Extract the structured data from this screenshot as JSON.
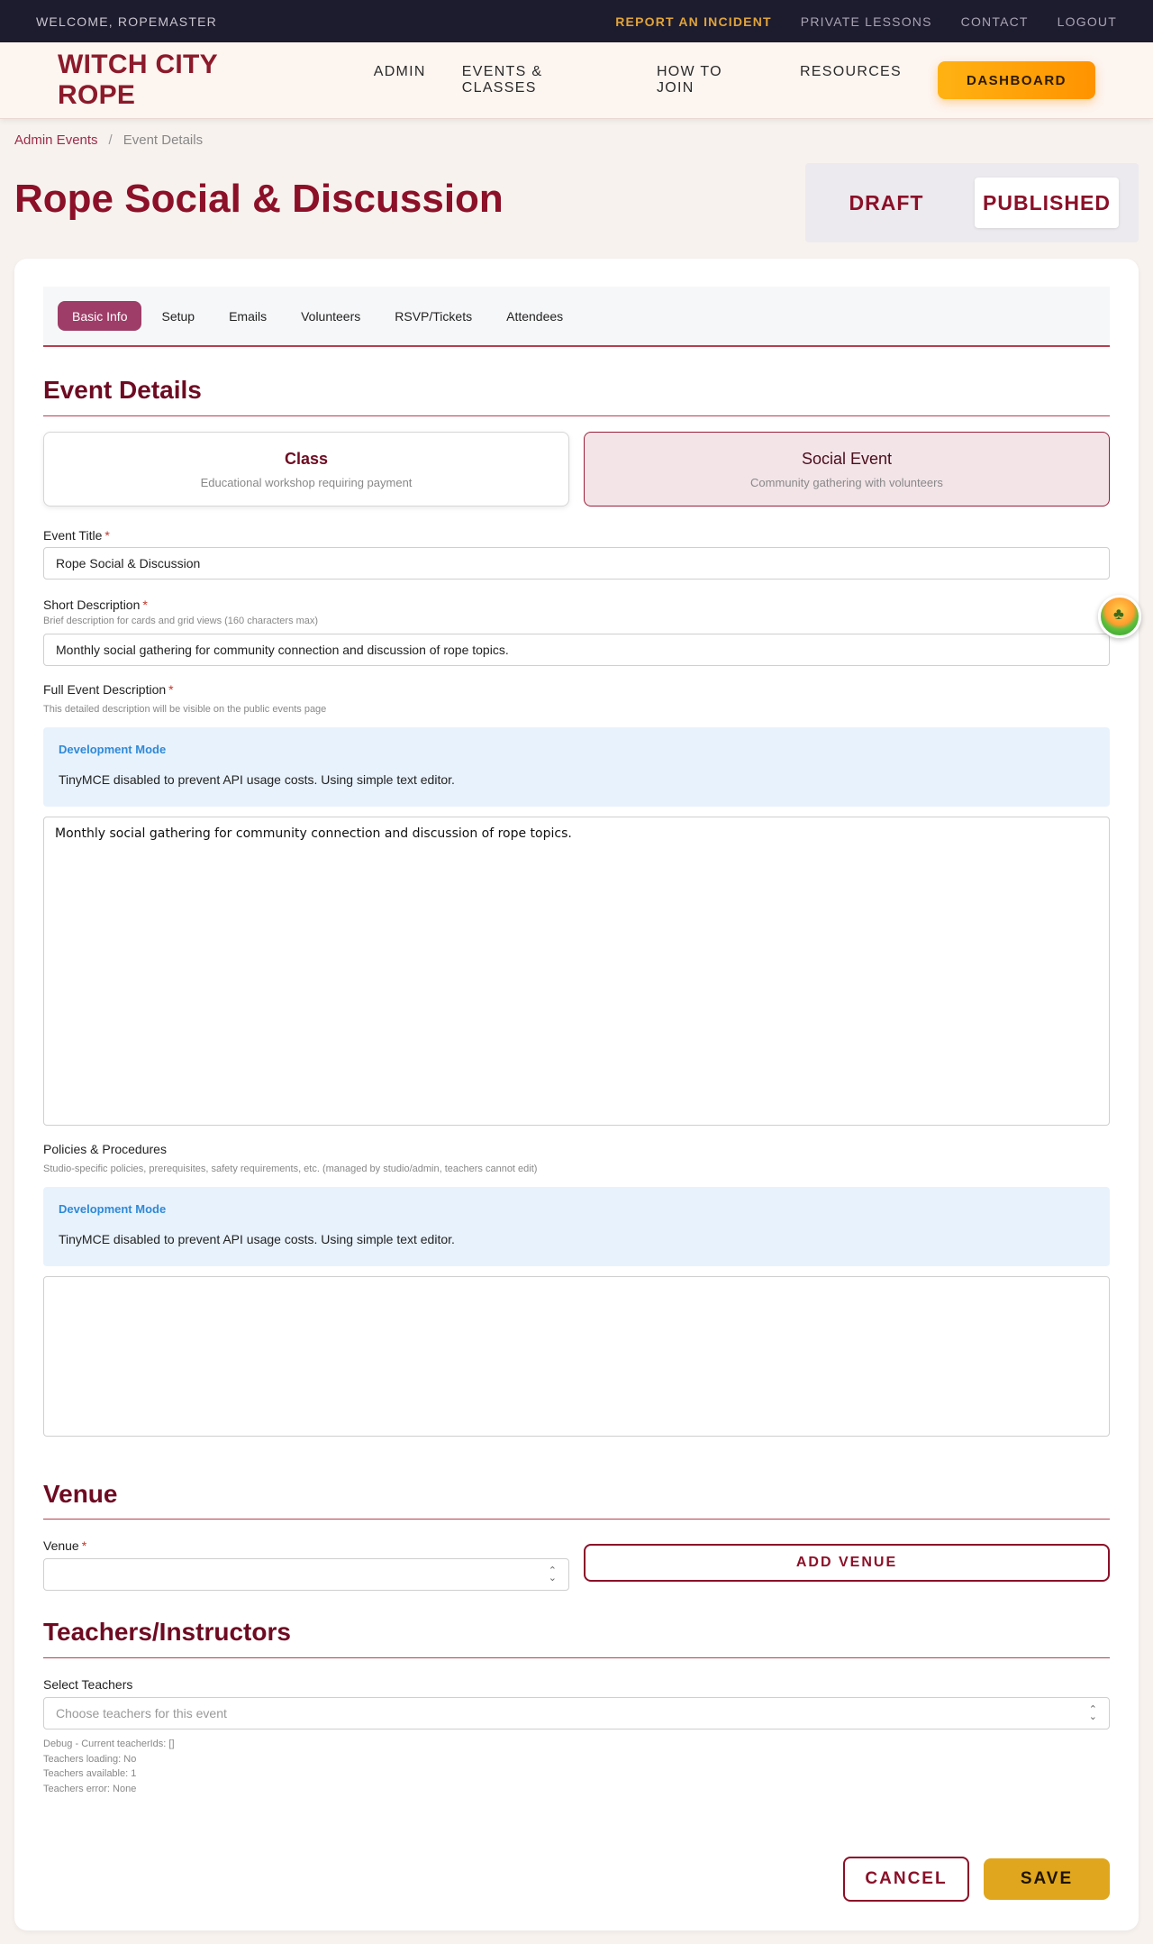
{
  "utilbar": {
    "welcome": "WELCOME, ROPEMASTER",
    "links": [
      "REPORT AN INCIDENT",
      "PRIVATE LESSONS",
      "CONTACT",
      "LOGOUT"
    ]
  },
  "nav": {
    "logo": "WITCH CITY ROPE",
    "links": [
      "ADMIN",
      "EVENTS & CLASSES",
      "HOW TO JOIN",
      "RESOURCES"
    ],
    "dashboard": "DASHBOARD"
  },
  "breadcrumb": {
    "parent": "Admin Events",
    "separator": "/",
    "current": "Event Details"
  },
  "page_title": "Rope Social & Discussion",
  "status": {
    "draft": "DRAFT",
    "published": "PUBLISHED",
    "selected": "PUBLISHED"
  },
  "tabs": [
    "Basic Info",
    "Setup",
    "Emails",
    "Volunteers",
    "RSVP/Tickets",
    "Attendees"
  ],
  "active_tab": "Basic Info",
  "event_details": {
    "section_title": "Event Details",
    "types": [
      {
        "title": "Class",
        "desc": "Educational workshop requiring payment"
      },
      {
        "title": "Social Event",
        "desc": "Community gathering with volunteers"
      }
    ],
    "selected_type": "Social Event",
    "title_label": "Event Title",
    "title_value": "Rope Social & Discussion",
    "short_label": "Short Description",
    "short_hint": "Brief description for cards and grid views (160 characters max)",
    "short_value": "Monthly social gathering for community connection and discussion of rope topics.",
    "full_label": "Full Event Description",
    "full_hint": "This detailed description will be visible on the public events page",
    "full_value": "Monthly social gathering for community connection and discussion of rope topics.",
    "policies_label": "Policies & Procedures",
    "policies_hint": "Studio-specific policies, prerequisites, safety requirements, etc. (managed by studio/admin, teachers cannot edit)",
    "policies_value": "",
    "required_mark": "*"
  },
  "dev_notice": {
    "title": "Development Mode",
    "message": "TinyMCE disabled to prevent API usage costs. Using simple text editor."
  },
  "venue": {
    "section_title": "Venue",
    "label": "Venue",
    "value": "",
    "add_button": "ADD VENUE"
  },
  "teachers": {
    "section_title": "Teachers/Instructors",
    "label": "Select Teachers",
    "placeholder": "Choose teachers for this event",
    "debug": [
      "Debug - Current teacherIds: []",
      "Teachers loading: No",
      "Teachers available: 1",
      "Teachers error: None"
    ]
  },
  "actions": {
    "cancel": "CANCEL",
    "save": "SAVE"
  },
  "colors": {
    "brand": "#8b1028",
    "accent": "#ffa40a",
    "active_tab": "#9e3d68",
    "dev_notice_bg": "#e8f2fc"
  },
  "icons": {
    "select_chevron": "chevron-updown-icon",
    "floating_widget": "palm-tree-sun-icon"
  }
}
